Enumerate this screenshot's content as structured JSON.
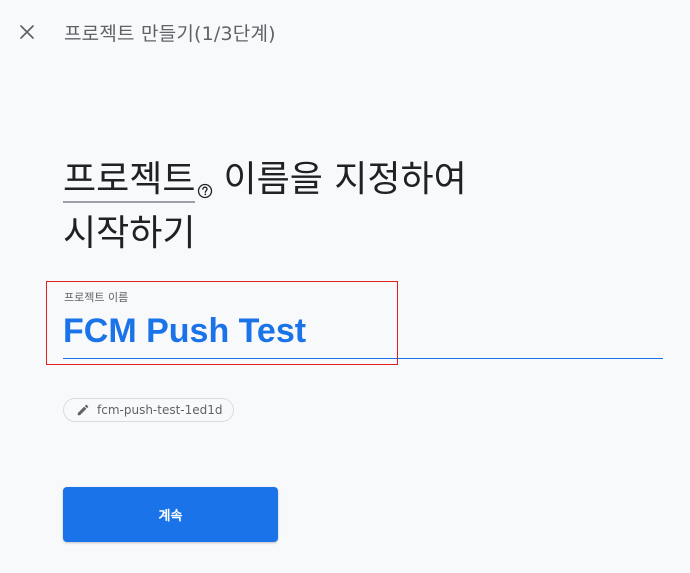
{
  "header": {
    "title": "프로젝트 만들기(1/3단계)",
    "close_icon": "close-icon"
  },
  "headline": {
    "term": "프로젝트",
    "help_icon": "help-circle-icon",
    "line1_rest": "이름을 지정하여",
    "line2": "시작하기"
  },
  "project_name_field": {
    "label": "프로젝트 이름",
    "value": "FCM Push Test"
  },
  "project_id_chip": {
    "icon": "pencil-icon",
    "text": "fcm-push-test-1ed1d"
  },
  "continue_button": {
    "label": "계속"
  },
  "colors": {
    "accent": "#1a73e8",
    "background": "#f8f9fa",
    "highlight": "#e02020",
    "muted_text": "#5f6368"
  }
}
